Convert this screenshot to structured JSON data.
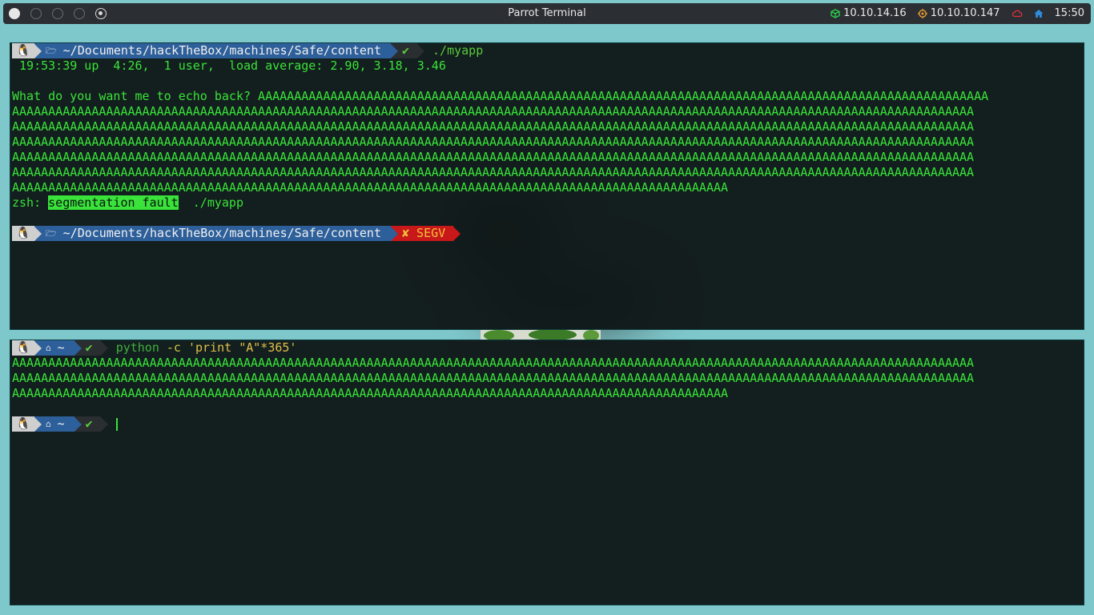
{
  "topbar": {
    "title": "Parrot Terminal",
    "vpn_ip": "10.10.14.16",
    "target_ip": "10.10.10.147",
    "time": "15:50",
    "colors": {
      "vpn": "#2bd34a",
      "target": "#f0a030",
      "cloud": "#e0303a",
      "home": "#2f8de0"
    }
  },
  "pane1": {
    "prompt1": {
      "path": "~/Documents/hackTheBox/machines/Safe/content",
      "status": "✔",
      "command": "./myapp"
    },
    "uptime": " 19:53:39 up  4:26,  1 user,  load average: 2.90, 3.18, 3.46",
    "blank": "",
    "echo_prompt": "What do you want me to echo back? ",
    "echo_lines": [
      "AAAAAAAAAAAAAAAAAAAAAAAAAAAAAAAAAAAAAAAAAAAAAAAAAAAAAAAAAAAAAAAAAAAAAAAAAAAAAAAAAAAAAAAAAAAAAAAAAAAAA",
      "AAAAAAAAAAAAAAAAAAAAAAAAAAAAAAAAAAAAAAAAAAAAAAAAAAAAAAAAAAAAAAAAAAAAAAAAAAAAAAAAAAAAAAAAAAAAAAAAAAAAAAAAAAAAAAAAAAAAAAAAAAAAAAAAAAAAA",
      "AAAAAAAAAAAAAAAAAAAAAAAAAAAAAAAAAAAAAAAAAAAAAAAAAAAAAAAAAAAAAAAAAAAAAAAAAAAAAAAAAAAAAAAAAAAAAAAAAAAAAAAAAAAAAAAAAAAAAAAAAAAAAAAAAAAAA",
      "AAAAAAAAAAAAAAAAAAAAAAAAAAAAAAAAAAAAAAAAAAAAAAAAAAAAAAAAAAAAAAAAAAAAAAAAAAAAAAAAAAAAAAAAAAAAAAAAAAAAAAAAAAAAAAAAAAAAAAAAAAAAAAAAAAAAA",
      "AAAAAAAAAAAAAAAAAAAAAAAAAAAAAAAAAAAAAAAAAAAAAAAAAAAAAAAAAAAAAAAAAAAAAAAAAAAAAAAAAAAAAAAAAAAAAAAAAAAAAAAAAAAAAAAAAAAAAAAAAAAAAAAAAAAAA",
      "AAAAAAAAAAAAAAAAAAAAAAAAAAAAAAAAAAAAAAAAAAAAAAAAAAAAAAAAAAAAAAAAAAAAAAAAAAAAAAAAAAAAAAAAAAAAAAAAAAAAAAAAAAAAAAAAAAAAAAAAAAAAAAAAAAAAA",
      "AAAAAAAAAAAAAAAAAAAAAAAAAAAAAAAAAAAAAAAAAAAAAAAAAAAAAAAAAAAAAAAAAAAAAAAAAAAAAAAAAAAAAAAAAAAAAAAAAAA"
    ],
    "segv_prefix": "zsh: ",
    "segv_text": "segmentation fault",
    "segv_suffix": "  ./myapp",
    "prompt2": {
      "path": "~/Documents/hackTheBox/machines/Safe/content",
      "status": "✘ SEGV"
    }
  },
  "pane2": {
    "prompt1": {
      "path": "~",
      "status": "✔",
      "cmd_exec": "python",
      "cmd_flag": " -c ",
      "cmd_str": "'print \"A\"*365'"
    },
    "output_lines": [
      "AAAAAAAAAAAAAAAAAAAAAAAAAAAAAAAAAAAAAAAAAAAAAAAAAAAAAAAAAAAAAAAAAAAAAAAAAAAAAAAAAAAAAAAAAAAAAAAAAAAAAAAAAAAAAAAAAAAAAAAAAAAAAAAAAAAAA",
      "AAAAAAAAAAAAAAAAAAAAAAAAAAAAAAAAAAAAAAAAAAAAAAAAAAAAAAAAAAAAAAAAAAAAAAAAAAAAAAAAAAAAAAAAAAAAAAAAAAAAAAAAAAAAAAAAAAAAAAAAAAAAAAAAAAAAA",
      "AAAAAAAAAAAAAAAAAAAAAAAAAAAAAAAAAAAAAAAAAAAAAAAAAAAAAAAAAAAAAAAAAAAAAAAAAAAAAAAAAAAAAAAAAAAAAAAAAAA"
    ],
    "prompt2": {
      "path": "~",
      "status": "✔"
    }
  }
}
